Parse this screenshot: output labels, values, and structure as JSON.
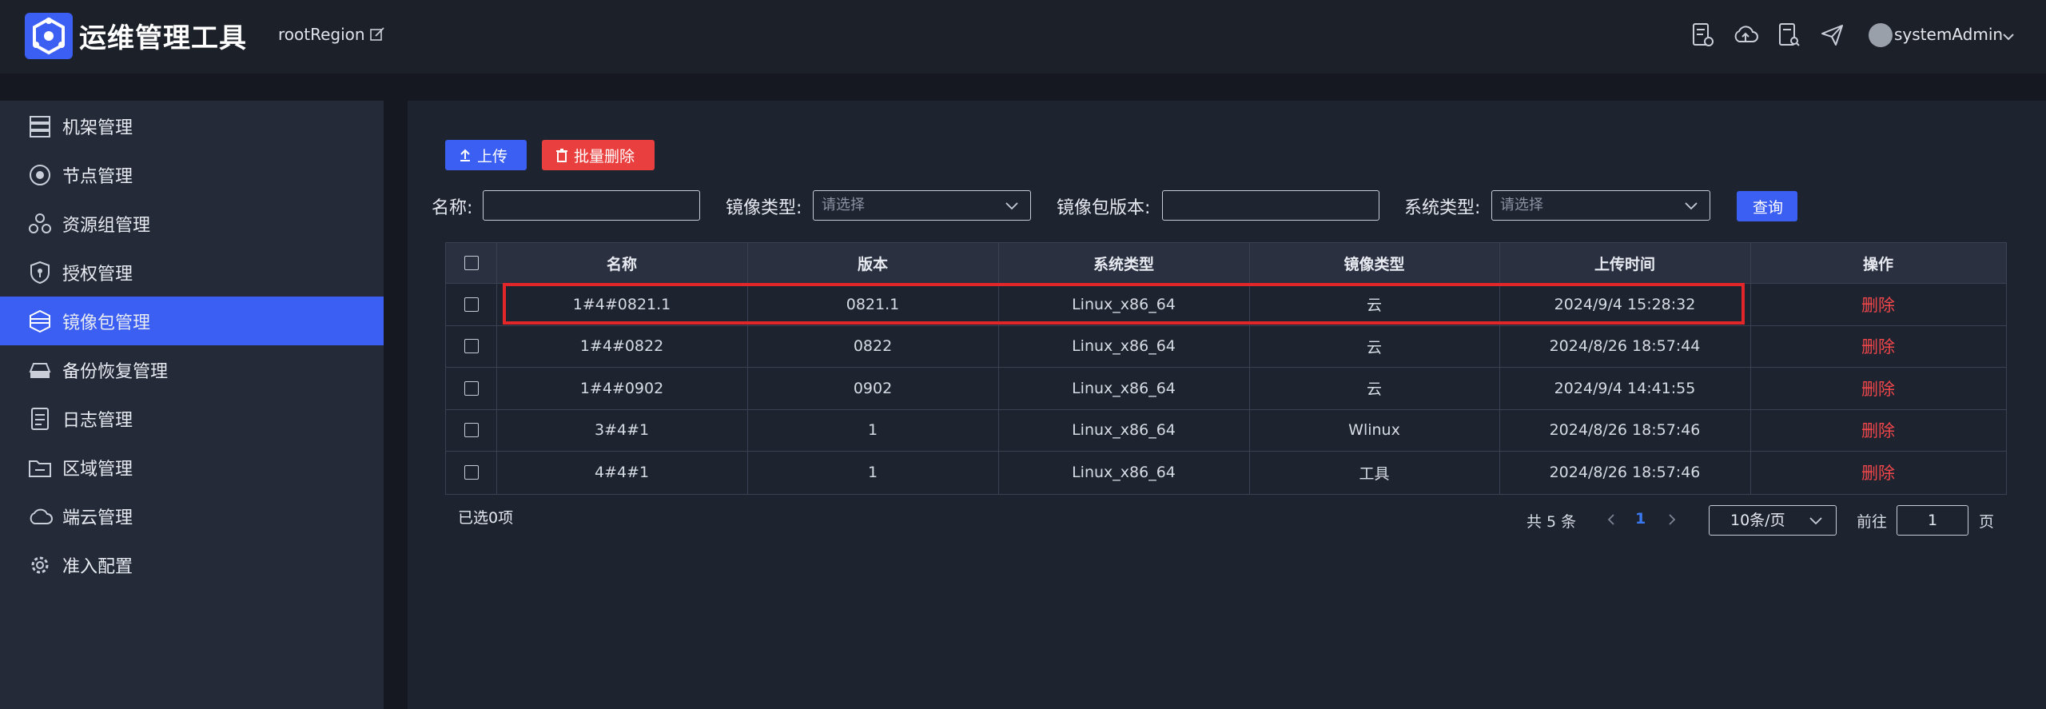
{
  "header": {
    "app_title": "运维管理工具",
    "region": "rootRegion",
    "user": "systemAdmin",
    "icons": [
      "document-settings-icon",
      "cloud-upload-icon",
      "file-search-icon",
      "send-icon"
    ]
  },
  "sidebar": {
    "items": [
      {
        "label": "机架管理",
        "icon": "rack-icon",
        "active": false
      },
      {
        "label": "节点管理",
        "icon": "node-icon",
        "active": false
      },
      {
        "label": "资源组管理",
        "icon": "resource-group-icon",
        "active": false
      },
      {
        "label": "授权管理",
        "icon": "shield-icon",
        "active": false
      },
      {
        "label": "镜像包管理",
        "icon": "image-package-icon",
        "active": true
      },
      {
        "label": "备份恢复管理",
        "icon": "backup-drive-icon",
        "active": false
      },
      {
        "label": "日志管理",
        "icon": "log-document-icon",
        "active": false
      },
      {
        "label": "区域管理",
        "icon": "region-folder-icon",
        "active": false
      },
      {
        "label": "端云管理",
        "icon": "cloud-icon",
        "active": false
      },
      {
        "label": "准入配置",
        "icon": "gear-icon",
        "active": false
      }
    ]
  },
  "toolbar": {
    "upload_label": "上传",
    "batch_delete_label": "批量删除"
  },
  "filters": {
    "name_label": "名称:",
    "name_value": "",
    "image_type_label": "镜像类型:",
    "image_type_placeholder": "请选择",
    "version_label": "镜像包版本:",
    "version_value": "",
    "system_type_label": "系统类型:",
    "system_type_placeholder": "请选择",
    "query_label": "查询"
  },
  "table": {
    "headers": [
      "名称",
      "版本",
      "系统类型",
      "镜像类型",
      "上传时间",
      "操作"
    ],
    "rows": [
      {
        "name": "1#4#0821.1",
        "version": "0821.1",
        "system": "Linux_x86_64",
        "type": "云",
        "time": "2024/9/4 15:28:32",
        "action": "删除"
      },
      {
        "name": "1#4#0822",
        "version": "0822",
        "system": "Linux_x86_64",
        "type": "云",
        "time": "2024/8/26 18:57:44",
        "action": "删除"
      },
      {
        "name": "1#4#0902",
        "version": "0902",
        "system": "Linux_x86_64",
        "type": "云",
        "time": "2024/9/4 14:41:55",
        "action": "删除"
      },
      {
        "name": "3#4#1",
        "version": "1",
        "system": "Linux_x86_64",
        "type": "Wlinux",
        "time": "2024/8/26 18:57:46",
        "action": "删除"
      },
      {
        "name": "4#4#1",
        "version": "1",
        "system": "Linux_x86_64",
        "type": "工具",
        "time": "2024/8/26 18:57:46",
        "action": "删除"
      }
    ]
  },
  "footer": {
    "selected": "已选0项",
    "total": "共 5 条",
    "current_page": "1",
    "page_size": "10条/页",
    "goto_label": "前往",
    "goto_value": "1",
    "page_suffix": "页"
  },
  "colors": {
    "accent": "#3b5ef3",
    "danger": "#e9403f",
    "highlight": "#e3262a"
  }
}
